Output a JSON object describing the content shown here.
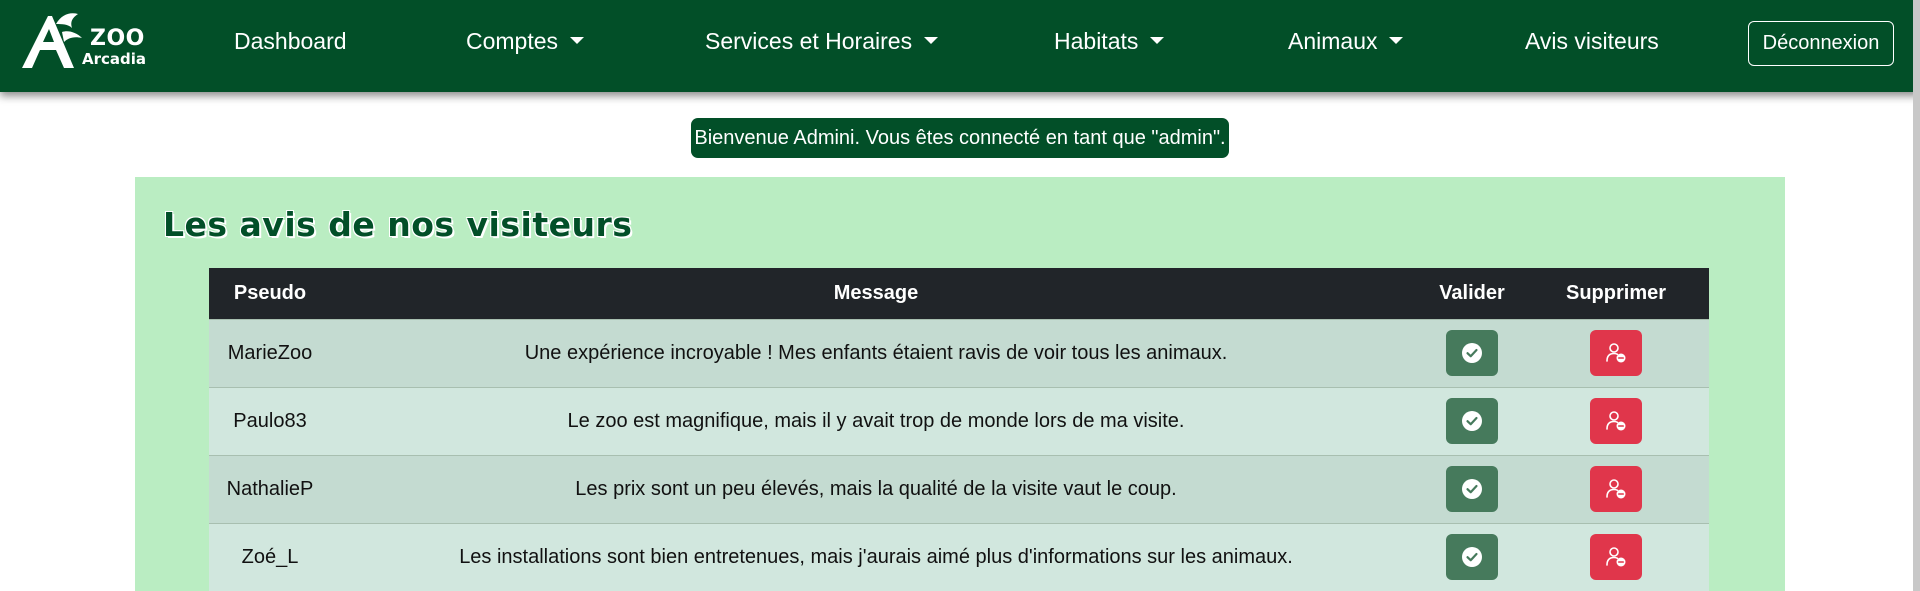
{
  "navbar": {
    "logo": {
      "line1": "ZOO",
      "line2": "Arcadia",
      "icon": "zoo-logo"
    },
    "items": [
      {
        "label": "Dashboard",
        "dropdown": false
      },
      {
        "label": "Comptes",
        "dropdown": true
      },
      {
        "label": "Services et Horaires",
        "dropdown": true
      },
      {
        "label": "Habitats",
        "dropdown": true
      },
      {
        "label": "Animaux",
        "dropdown": true
      },
      {
        "label": "Avis visiteurs",
        "dropdown": false
      }
    ],
    "logout_label": "Déconnexion"
  },
  "welcome_message": "Bienvenue Admini. Vous êtes connecté en tant que \"admin\".",
  "section_title": "Les avis de nos visiteurs",
  "table": {
    "headers": {
      "pseudo": "Pseudo",
      "message": "Message",
      "validate": "Valider",
      "delete": "Supprimer"
    },
    "rows": [
      {
        "pseudo": "MarieZoo",
        "message": "Une expérience incroyable ! Mes enfants étaient ravis de voir tous les animaux."
      },
      {
        "pseudo": "Paulo83",
        "message": "Le zoo est magnifique, mais il y avait trop de monde lors de ma visite."
      },
      {
        "pseudo": "NathalieP",
        "message": "Les prix sont un peu élevés, mais la qualité de la visite vaut le coup."
      },
      {
        "pseudo": "Zoé_L",
        "message": "Les installations sont bien entretenues, mais j'aurais aimé plus d'informations sur les animaux."
      }
    ]
  },
  "icons": {
    "validate": "check-circle-icon",
    "delete": "person-remove-icon"
  },
  "colors": {
    "primary_green": "#024f28",
    "panel_bg": "#baedc2",
    "table_header": "#212529",
    "validate_button": "#467a5c",
    "delete_button": "#e0364b"
  }
}
